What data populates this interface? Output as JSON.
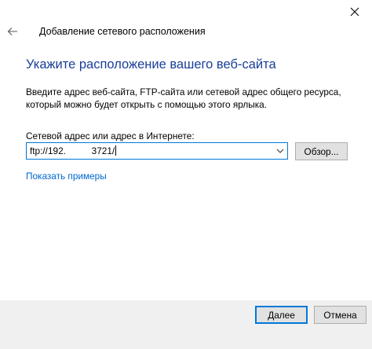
{
  "window": {
    "close_icon": "close-icon",
    "back_icon": "back-arrow-icon",
    "title": "Добавление сетевого расположения"
  },
  "page": {
    "heading": "Укажите расположение вашего веб-сайта",
    "description": "Введите адрес веб-сайта, FTP-сайта или сетевой адрес общего ресурса, который можно будет открыть с помощью этого ярлыка.",
    "address_label": "Сетевой адрес или адрес в Интернете:",
    "address_value": "ftp://192.          3721/",
    "browse_label": "Обзор...",
    "examples_link": "Показать примеры"
  },
  "footer": {
    "next_label": "Далее",
    "cancel_label": "Отмена"
  },
  "colors": {
    "heading": "#1a3e99",
    "link": "#0066cc",
    "accent": "#0078d7",
    "footer_bg": "#f0f0f0"
  }
}
